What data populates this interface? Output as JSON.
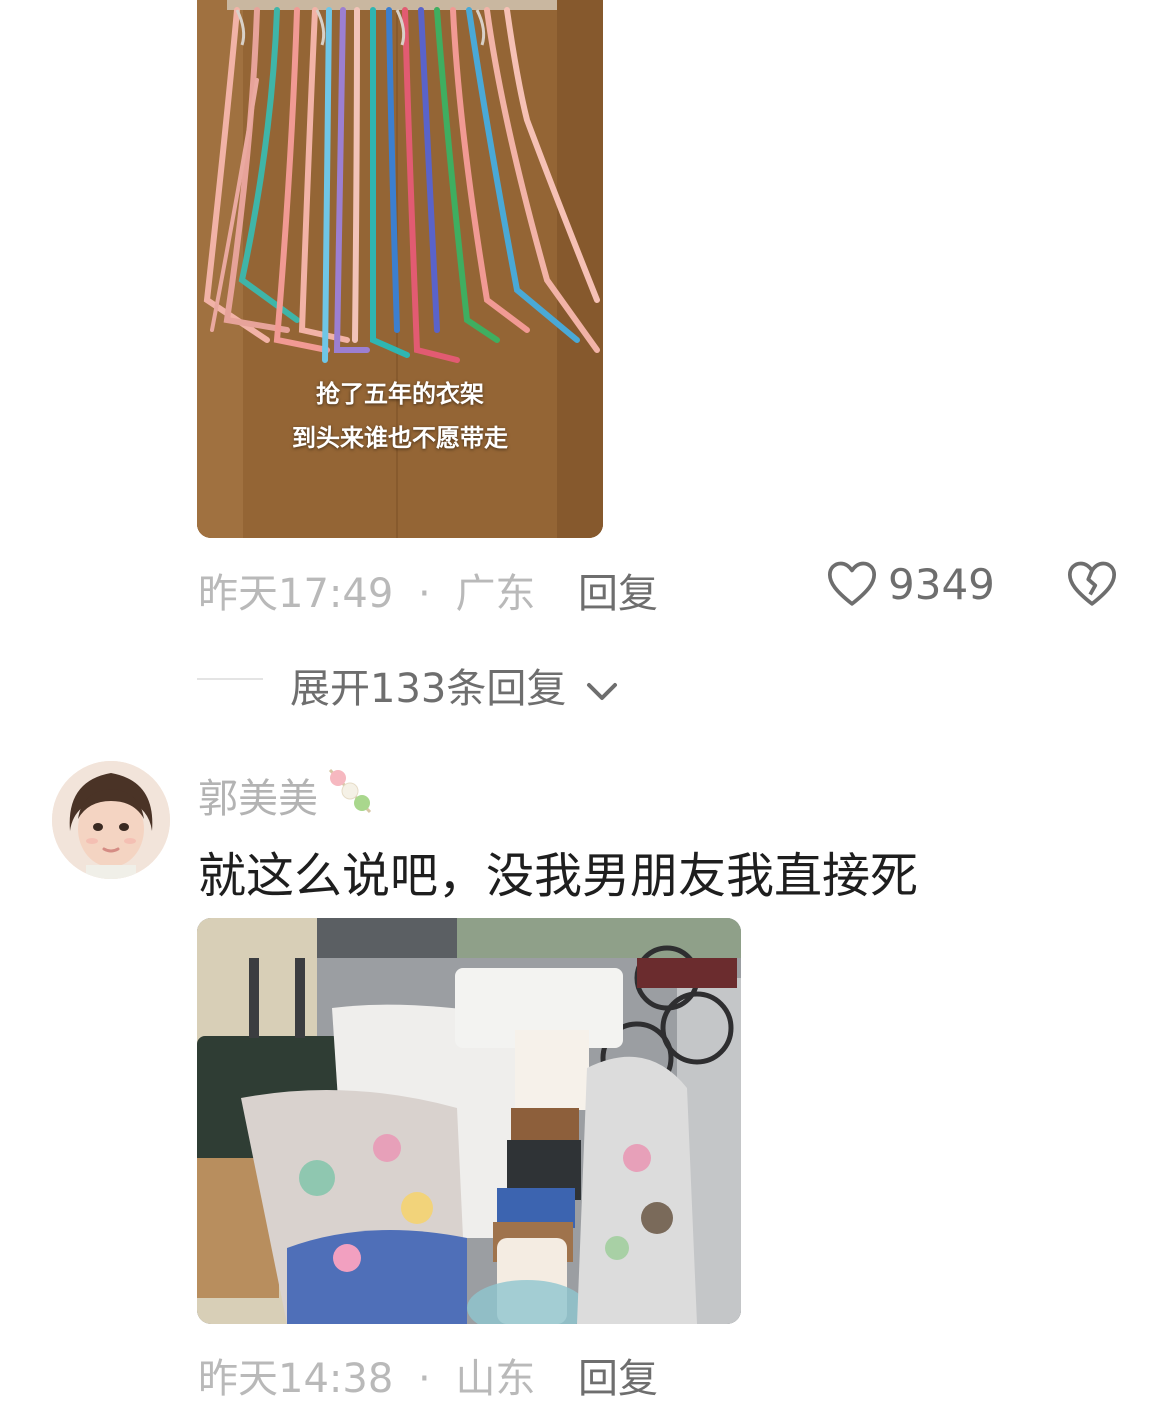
{
  "comment1": {
    "image_caption_line1": "抢了五年的衣架",
    "image_caption_line2": "到头来谁也不愿带走",
    "time": "昨天17:49",
    "separator": "·",
    "location": "广东",
    "reply_label": "回复",
    "like_count": "9349",
    "expand_label": "展开133条回复"
  },
  "comment2": {
    "username": "郭美美",
    "text": "就这么说吧，没我男朋友我直接死",
    "time": "昨天14:38",
    "separator": "·",
    "location": "山东",
    "reply_label": "回复"
  },
  "icons": {
    "like": "heart-outline-icon",
    "dislike": "broken-heart-icon",
    "expand": "chevron-down-icon",
    "username_badge": "candy-skewer-icon"
  },
  "colors": {
    "text_primary": "#1e1e1e",
    "text_secondary": "#6e6e6e",
    "text_meta": "#b9b9b9"
  }
}
